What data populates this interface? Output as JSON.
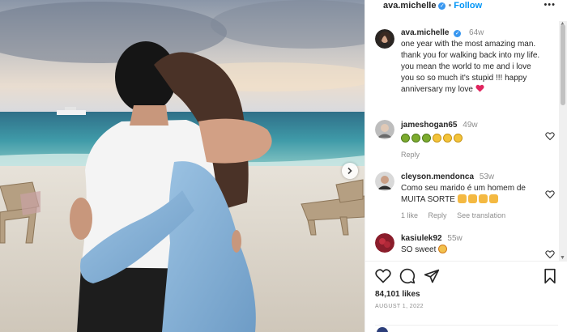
{
  "post": {
    "author": "ava.michelle",
    "follow_label": "Follow",
    "more_glyph": "•••"
  },
  "caption": {
    "author": "ava.michelle",
    "time": "64w",
    "line1": "one year with the most amazing man.",
    "line2": "thank you for walking back into my life.",
    "line3": "you mean the world to me and i love",
    "line4": "you so so much it's stupid !!! happy",
    "line5": "anniversary my love"
  },
  "comments": [
    {
      "author": "jameshogan65",
      "time": "49w",
      "emojis": [
        "sick",
        "sick",
        "sick",
        "cry",
        "cry",
        "cry"
      ],
      "actions": [
        "Reply"
      ]
    },
    {
      "author": "cleyson.mendonca",
      "time": "53w",
      "line1": "Como seu marido é um homem de",
      "line2": "MUITA SORTE",
      "emojis": [
        "clap",
        "clap",
        "clap",
        "clap"
      ],
      "actions": [
        "1 like",
        "Reply",
        "See translation"
      ]
    },
    {
      "author": "kasiulek92",
      "time": "55w",
      "text": "SO sweet",
      "emojis": [
        "love"
      ]
    }
  ],
  "engagement": {
    "likes": "84,101 likes",
    "date": "AUGUST 1, 2022"
  },
  "icons": {
    "like": "heart-icon",
    "comment": "comment-icon",
    "share": "share-icon",
    "save": "bookmark-icon",
    "next": "chevron-right-icon"
  },
  "colors": {
    "link": "#0095f6",
    "verified": "#3897f0",
    "heart": "#ed4956"
  }
}
